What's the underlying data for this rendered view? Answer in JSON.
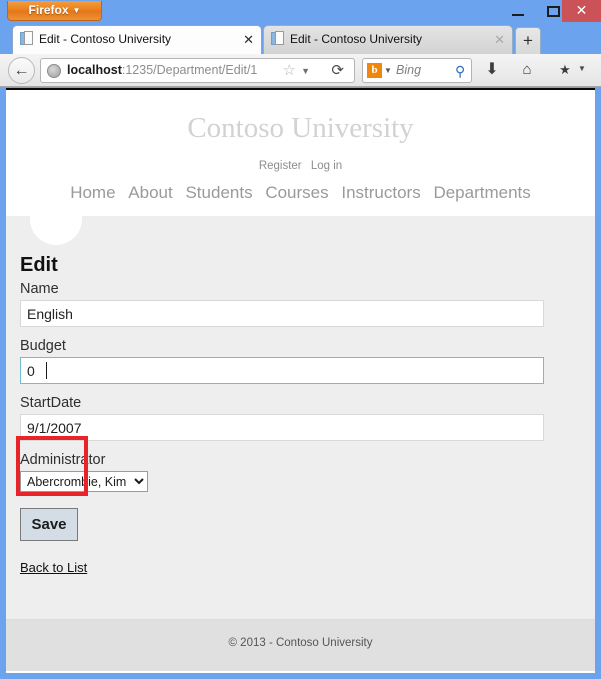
{
  "window": {
    "app_button_label": "Firefox",
    "minimize_label": "–",
    "maximize_label": "□",
    "close_label": "✕"
  },
  "tabs": [
    {
      "title": "Edit - Contoso University",
      "close_label": "✕",
      "active": true
    },
    {
      "title": "Edit - Contoso University",
      "close_label": "✕",
      "active": false
    }
  ],
  "newtab_label": "+",
  "toolbar": {
    "back_label": "←",
    "url_host": "localhost",
    "url_path": ":1235/Department/Edit/1",
    "star_label": "☆",
    "dropmarker_label": "▼",
    "reload_label": "⟳",
    "search_engine": "b",
    "search_engine_caret": "▼",
    "search_placeholder": "Bing",
    "search_go_label": "⚲",
    "download_label": "⬇",
    "home_label": "⌂",
    "bookmarks_label": "★",
    "bookmarks_caret": "▼"
  },
  "page": {
    "brand": "Contoso University",
    "account_nav": [
      {
        "label": "Register"
      },
      {
        "label": "Log in"
      }
    ],
    "main_nav": [
      {
        "label": "Home"
      },
      {
        "label": "About"
      },
      {
        "label": "Students"
      },
      {
        "label": "Courses"
      },
      {
        "label": "Instructors"
      },
      {
        "label": "Departments"
      }
    ],
    "heading": "Edit",
    "fields": {
      "name": {
        "label": "Name",
        "value": "English"
      },
      "budget": {
        "label": "Budget",
        "value": "0"
      },
      "startdate": {
        "label": "StartDate",
        "value": "9/1/2007"
      },
      "administrator": {
        "label": "Administrator",
        "value": "Abercrombie, Kim"
      }
    },
    "save_label": "Save",
    "back_to_list_label": "Back to List",
    "footer": "© 2013 - Contoso University"
  },
  "annotation": {
    "color": "#e8232a"
  }
}
